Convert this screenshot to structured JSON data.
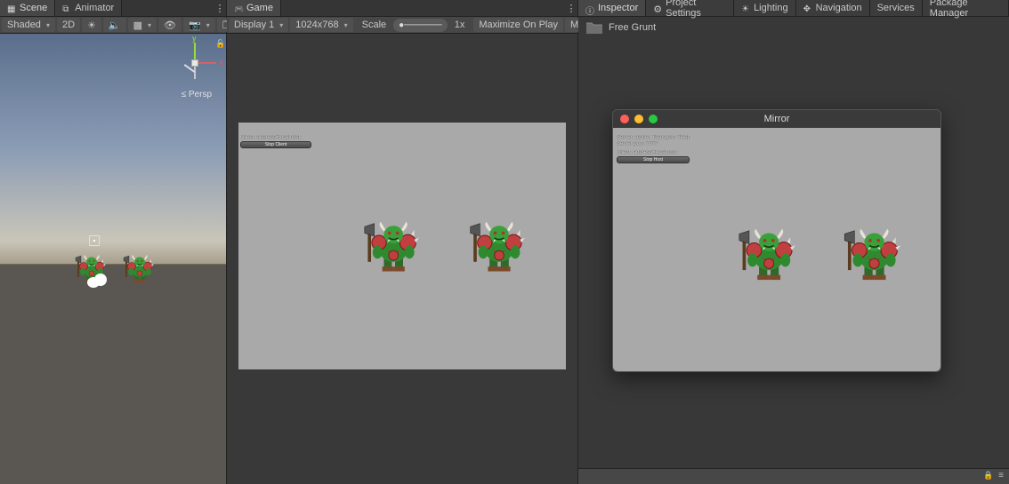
{
  "scene": {
    "tabs": {
      "scene": "Scene",
      "animator": "Animator"
    },
    "toolbar": {
      "shaded": "Shaded",
      "mode2d": "2D",
      "gizmo_count": "0"
    },
    "persp_label": "≤ Persp",
    "axis": {
      "x": "x",
      "y": "y"
    }
  },
  "game": {
    "tab": "Game",
    "toolbar": {
      "display": "Display 1",
      "resolution": "1024x768",
      "scale_label": "Scale",
      "scale_value": "1x",
      "maximize": "Maximize On Play",
      "mute": "Mute Audio"
    },
    "hud": {
      "client_line": "Client: address=localhost:",
      "stop_client_btn": "Stop Client"
    }
  },
  "inspector": {
    "tabs": {
      "inspector": "Inspector",
      "project_settings": "Project Settings",
      "lighting": "Lighting",
      "navigation": "Navigation",
      "services": "Services",
      "package_manager": "Package Manager"
    },
    "asset_name": "Free Grunt"
  },
  "mirror": {
    "title": "Mirror",
    "hud": {
      "line1": "Server: active. Transport: Telepathy",
      "line2": "Server port: 7777",
      "line3": "Client: address=localhost:",
      "stop_host_btn": "Stop Host"
    }
  },
  "statusbar": {
    "lock": "🔒",
    "menu": "≡"
  }
}
